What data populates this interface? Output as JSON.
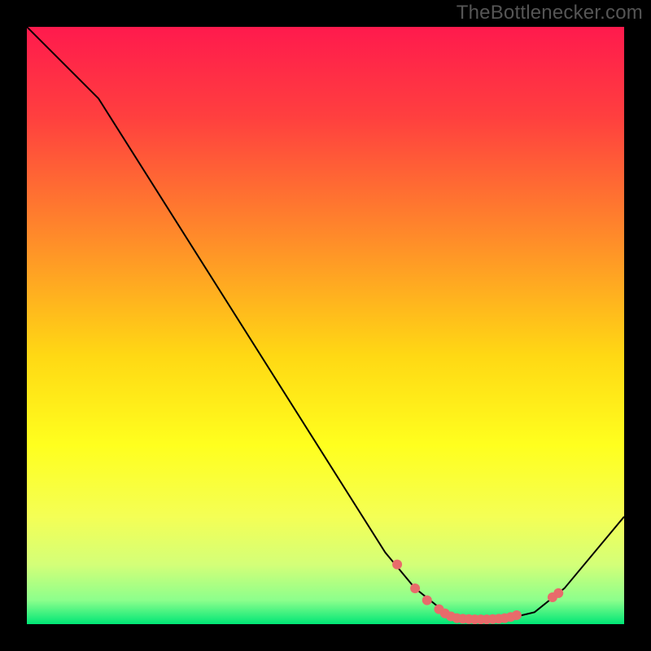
{
  "watermark": "TheBottlenecker.com",
  "chart_data": {
    "type": "line",
    "title": "",
    "xlabel": "",
    "ylabel": "",
    "xlim": [
      0,
      100
    ],
    "ylim": [
      0,
      100
    ],
    "background_gradient_stops": [
      {
        "offset": 0.0,
        "color": "#ff1a4d"
      },
      {
        "offset": 0.15,
        "color": "#ff3f3f"
      },
      {
        "offset": 0.35,
        "color": "#ff8a2a"
      },
      {
        "offset": 0.55,
        "color": "#ffd814"
      },
      {
        "offset": 0.7,
        "color": "#ffff1e"
      },
      {
        "offset": 0.82,
        "color": "#f4ff55"
      },
      {
        "offset": 0.9,
        "color": "#d4ff78"
      },
      {
        "offset": 0.96,
        "color": "#8cff8c"
      },
      {
        "offset": 1.0,
        "color": "#00e676"
      }
    ],
    "curve_points": [
      {
        "x": 0,
        "y": 100
      },
      {
        "x": 8,
        "y": 92
      },
      {
        "x": 12,
        "y": 88
      },
      {
        "x": 60,
        "y": 12
      },
      {
        "x": 65,
        "y": 6
      },
      {
        "x": 70,
        "y": 2
      },
      {
        "x": 75,
        "y": 0.8
      },
      {
        "x": 80,
        "y": 0.8
      },
      {
        "x": 85,
        "y": 2
      },
      {
        "x": 90,
        "y": 6
      },
      {
        "x": 100,
        "y": 18
      }
    ],
    "markers": [
      {
        "x": 62,
        "y": 10.0
      },
      {
        "x": 65,
        "y": 6.0
      },
      {
        "x": 67,
        "y": 4.0
      },
      {
        "x": 69,
        "y": 2.5
      },
      {
        "x": 70,
        "y": 1.8
      },
      {
        "x": 71,
        "y": 1.3
      },
      {
        "x": 72,
        "y": 1.0
      },
      {
        "x": 73,
        "y": 0.9
      },
      {
        "x": 74,
        "y": 0.85
      },
      {
        "x": 75,
        "y": 0.8
      },
      {
        "x": 76,
        "y": 0.8
      },
      {
        "x": 77,
        "y": 0.8
      },
      {
        "x": 78,
        "y": 0.85
      },
      {
        "x": 79,
        "y": 0.9
      },
      {
        "x": 80,
        "y": 1.0
      },
      {
        "x": 81,
        "y": 1.2
      },
      {
        "x": 82,
        "y": 1.5
      },
      {
        "x": 88,
        "y": 4.5
      },
      {
        "x": 89,
        "y": 5.2
      }
    ],
    "marker_color": "#e86b6b",
    "curve_color": "#000000"
  }
}
